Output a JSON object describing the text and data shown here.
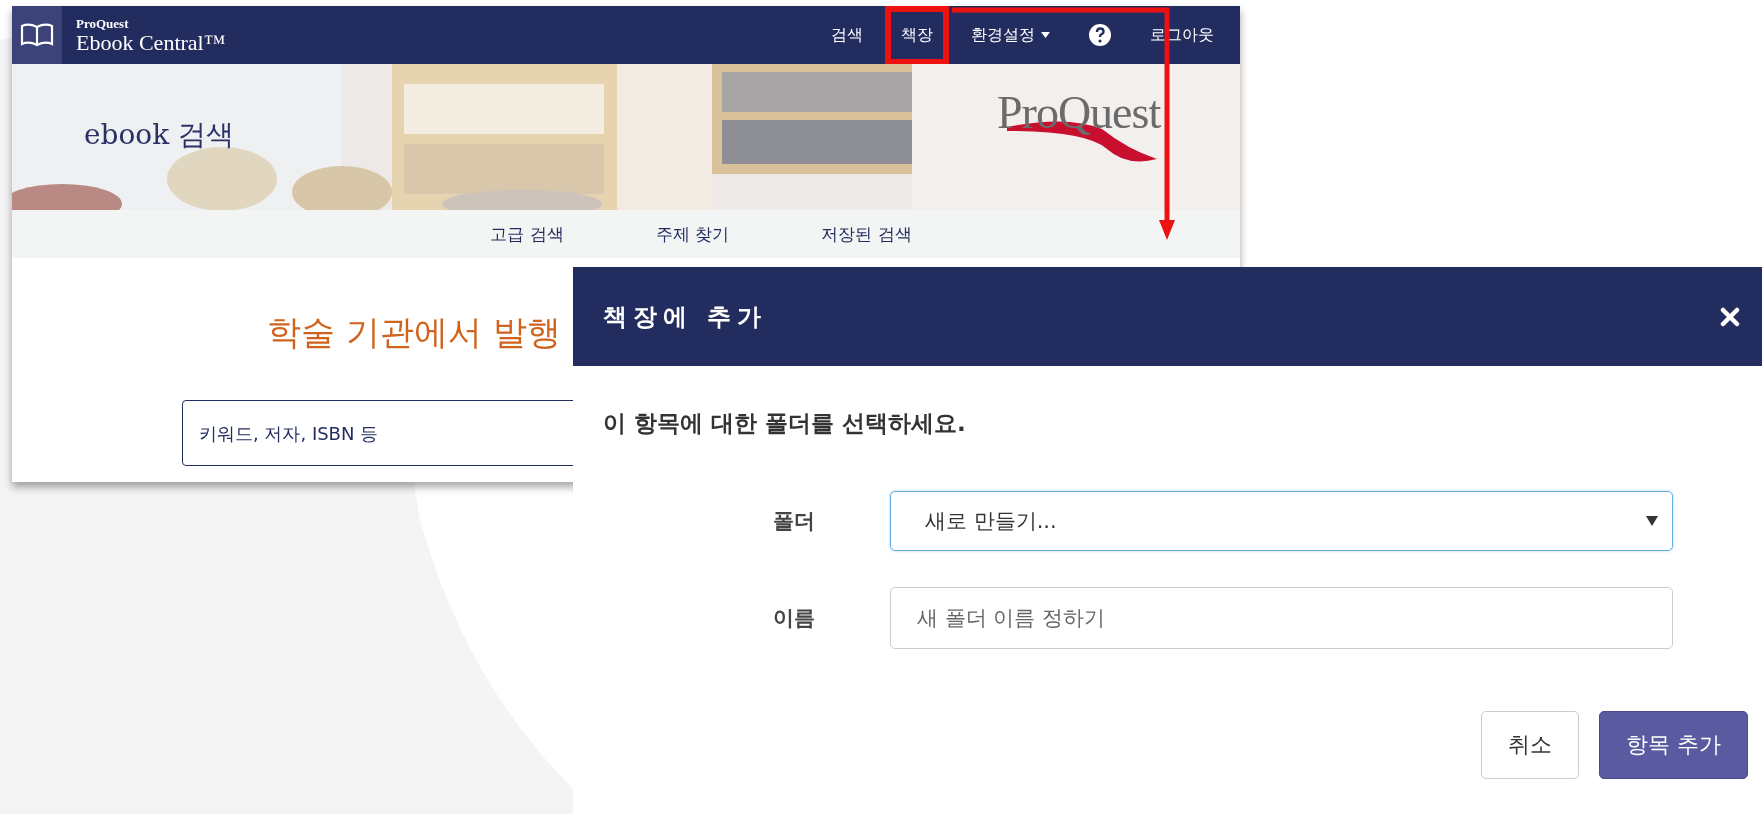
{
  "site": {
    "header": {
      "brand_small": "ProQuest",
      "brand": "Ebook Central™",
      "nav": [
        {
          "kind": "link",
          "label": "검색",
          "highlighted": false
        },
        {
          "kind": "link",
          "label": "책장",
          "highlighted": true
        },
        {
          "kind": "menu",
          "label": "환경설정",
          "highlighted": false
        },
        {
          "kind": "help",
          "highlighted": false
        },
        {
          "kind": "link",
          "label": "로그아웃",
          "highlighted": false
        }
      ]
    },
    "banner": {
      "title": "ebook 검색",
      "logo": "ProQuest"
    },
    "subnav": [
      "고급 검색",
      "주제 찾기",
      "저장된 검색"
    ],
    "headline": "학술 기관에서 발행",
    "search": {
      "placeholder": "키워드, 저자, ISBN 등"
    }
  },
  "dialog": {
    "title": "책장에 추가",
    "prompt": "이 항목에 대한 폴더를 선택하세요.",
    "fields": [
      {
        "kind": "select",
        "label": "폴더",
        "value": "새로 만들기..."
      },
      {
        "kind": "text",
        "label": "이름",
        "placeholder": "새 폴더 이름 정하기"
      }
    ],
    "buttons": [
      {
        "label": "취소",
        "primary": false
      },
      {
        "label": "항목 추가",
        "primary": true
      }
    ]
  }
}
